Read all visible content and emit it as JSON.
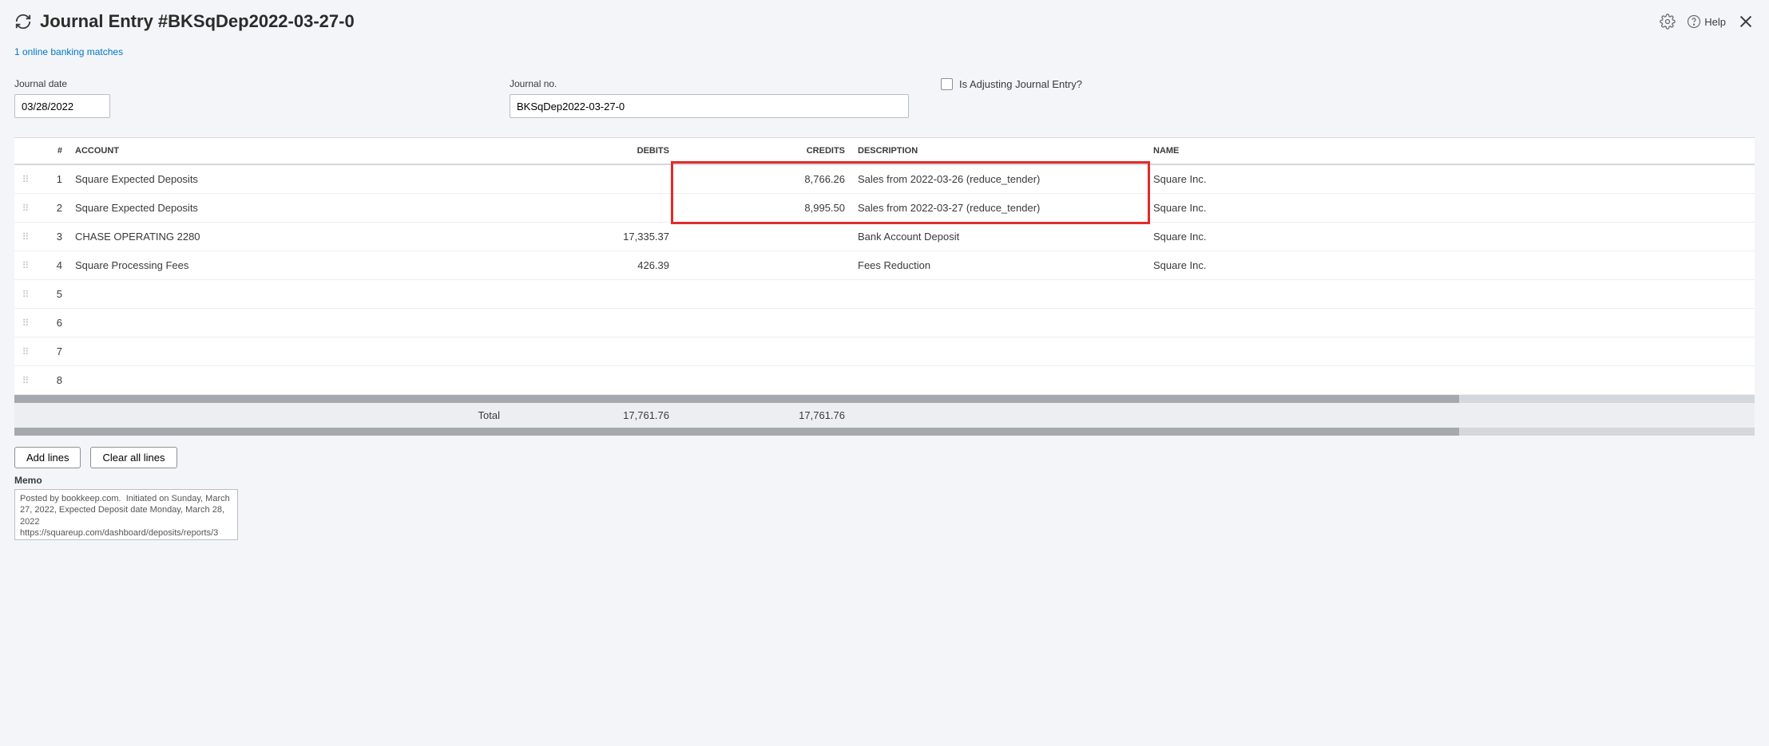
{
  "header": {
    "title": "Journal Entry #BKSqDep2022-03-27-0",
    "help_label": "Help"
  },
  "link_text": "1 online banking matches",
  "fields": {
    "date_label": "Journal date",
    "date_value": "03/28/2022",
    "no_label": "Journal no.",
    "no_value": "BKSqDep2022-03-27-0",
    "adjusting_label": "Is Adjusting Journal Entry?"
  },
  "columns": {
    "num": "#",
    "account": "ACCOUNT",
    "debits": "DEBITS",
    "credits": "CREDITS",
    "description": "DESCRIPTION",
    "name": "NAME"
  },
  "rows": [
    {
      "num": "1",
      "account": "Square Expected Deposits",
      "debits": "",
      "credits": "8,766.26",
      "description": "Sales from 2022-03-26 (reduce_tender)",
      "name": "Square Inc."
    },
    {
      "num": "2",
      "account": "Square Expected Deposits",
      "debits": "",
      "credits": "8,995.50",
      "description": "Sales from 2022-03-27 (reduce_tender)",
      "name": "Square Inc."
    },
    {
      "num": "3",
      "account": "CHASE OPERATING 2280",
      "debits": "17,335.37",
      "credits": "",
      "description": "Bank Account Deposit",
      "name": "Square Inc."
    },
    {
      "num": "4",
      "account": "Square Processing Fees",
      "debits": "426.39",
      "credits": "",
      "description": "Fees Reduction",
      "name": "Square Inc."
    },
    {
      "num": "5",
      "account": "",
      "debits": "",
      "credits": "",
      "description": "",
      "name": ""
    },
    {
      "num": "6",
      "account": "",
      "debits": "",
      "credits": "",
      "description": "",
      "name": ""
    },
    {
      "num": "7",
      "account": "",
      "debits": "",
      "credits": "",
      "description": "",
      "name": ""
    },
    {
      "num": "8",
      "account": "",
      "debits": "",
      "credits": "",
      "description": "",
      "name": ""
    }
  ],
  "totals": {
    "label": "Total",
    "debits": "17,761.76",
    "credits": "17,761.76"
  },
  "buttons": {
    "add": "Add lines",
    "clear": "Clear all lines"
  },
  "memo": {
    "label": "Memo",
    "value": "Posted by bookkeep.com.  Initiated on Sunday, March 27, 2022, Expected Deposit date Monday, March 28, 2022\nhttps://squareup.com/dashboard/deposits/reports/3"
  }
}
